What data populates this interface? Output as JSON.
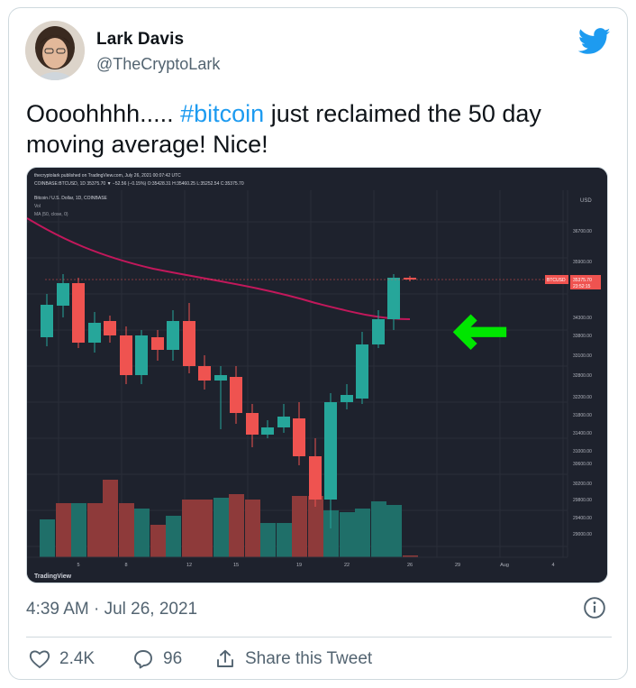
{
  "author": {
    "name": "Lark Davis",
    "handle": "@TheCryptoLark"
  },
  "tweet": {
    "text_prefix": "Oooohhhh..... ",
    "hashtag": "#bitcoin",
    "text_suffix": " just reclaimed the 50 day moving average! Nice!",
    "timestamp": "4:39 AM · Jul 26, 2021"
  },
  "actions": {
    "likes": "2.4K",
    "replies": "96",
    "share_label": "Share this Tweet"
  },
  "chart": {
    "header_line1": "thecryptolark published on TradingView.com, July 26, 2021 00:07:42 UTC",
    "header_line2": "COINBASE:BTCUSD, 1D 35375.70 ▼ −52.56 (−0.15%) O:35428.31 H:35460.25 L:35252.54 C:35375.70",
    "legend_line1": "Bitcoin / U.S. Dollar, 1D, COINBASE",
    "legend_line2": "Vol",
    "legend_line3": "MA (50, close, 0)",
    "currency": "USD",
    "price_tag": "BTCUSD",
    "price_tag_value": "35375.70",
    "price_tag_time": "23:52:15",
    "watermark": "TradingView",
    "x_ticks": [
      "5",
      "8",
      "12",
      "15",
      "19",
      "22",
      "26",
      "29",
      "Aug",
      "4"
    ],
    "y_ticks": [
      "36700.00",
      "35900.00",
      "34300.00",
      "33800.00",
      "33100.00",
      "32800.00",
      "32200.00",
      "31800.00",
      "31400.00",
      "31000.00",
      "30600.00",
      "30200.00",
      "29800.00",
      "29400.00",
      "29000.00"
    ],
    "up_color": "#26a69a",
    "down_color": "#ef5350",
    "ma_color": "#c2185b",
    "arrow_color": "#00e600"
  },
  "colors": {
    "link": "#1d9bf0",
    "secondary": "#536471",
    "bird": "#1d9bf0"
  }
}
